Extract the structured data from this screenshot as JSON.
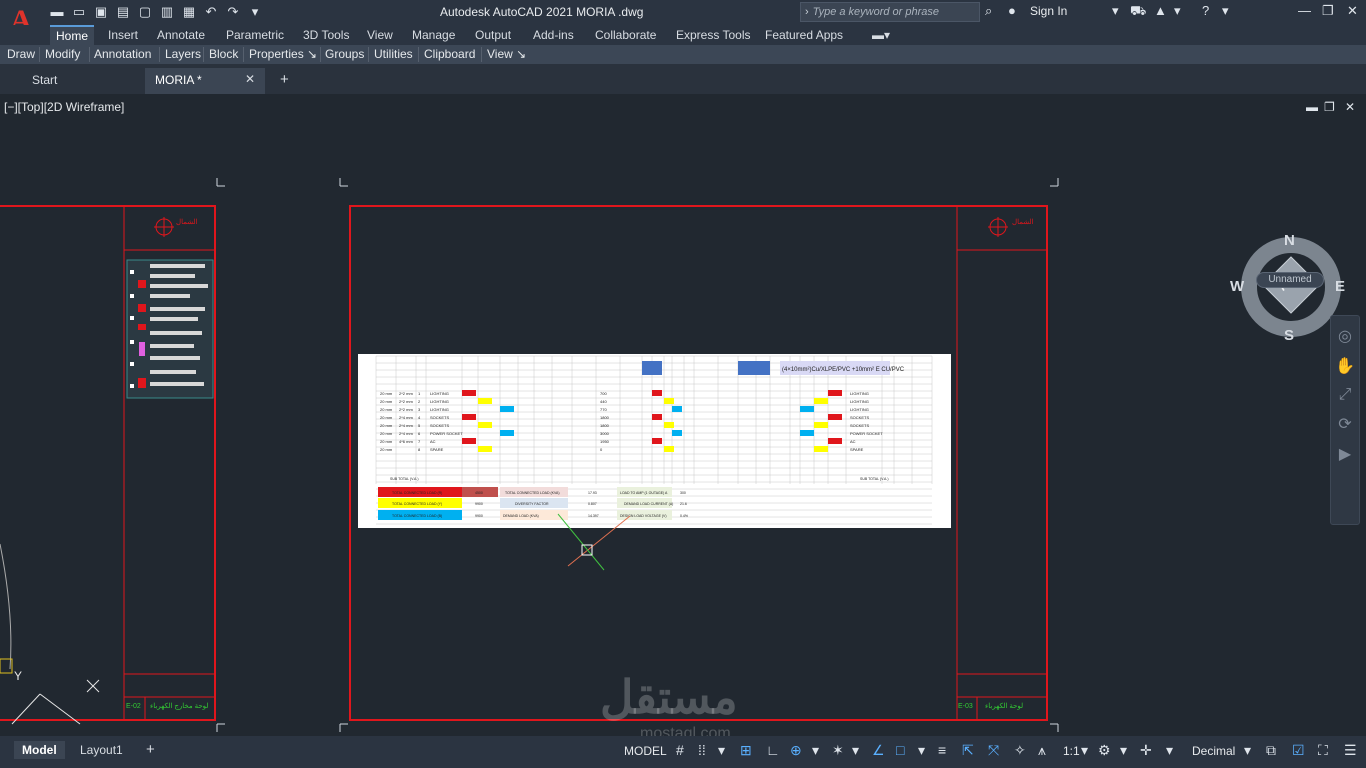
{
  "app": {
    "title": "Autodesk AutoCAD 2021   MORIA .dwg",
    "logo_letter": "A",
    "search_placeholder": "Type a keyword or phrase",
    "sign_in": "Sign In"
  },
  "ribbon": {
    "tabs": [
      "Home",
      "Insert",
      "Annotate",
      "Parametric",
      "3D Tools",
      "View",
      "Manage",
      "Output",
      "Add-ins",
      "Collaborate",
      "Express Tools",
      "Featured Apps"
    ],
    "active_tab": "Home",
    "panels": [
      "Draw",
      "Modify",
      "Annotation",
      "Layers",
      "Block",
      "Properties ↘",
      "Groups",
      "Utilities",
      "Clipboard",
      "View ↘"
    ]
  },
  "doc_tabs": {
    "start": "Start",
    "active": "MORIA *",
    "close": "✕",
    "add": "+"
  },
  "viewport": {
    "label": "[−][Top][2D Wireframe]",
    "nav_top": "TOP",
    "compass": {
      "n": "N",
      "s": "S",
      "e": "E",
      "w": "W"
    },
    "ucs_name": "Unnamed"
  },
  "sheets": {
    "left_sheet_code": "E-02",
    "right_sheet_code": "E-03",
    "left_footer_title": "لوحة مخارج الكهرباء",
    "right_footer_title": "لوحة الكهرباء",
    "logo_text": "الشمال"
  },
  "schedule": {
    "banner": "(4×10mm²)Cu/XLPE/PVC +10mm² E CU/PVC",
    "totals": {
      "sub_total_left": "SUB TOTAL (V.A.)",
      "sub_total_right": "SUB TOTAL (V.A.)",
      "row1": [
        "TOTAL CONNECTED LOAD (R)",
        "TOTAL CONNECTED LOAD (KVA)",
        "LOAD TO AMP (1 OUTAGE) A"
      ],
      "row2": [
        "TOTAL CONNECTED LOAD (Y)",
        "DIVERSITY FACTOR",
        "DEMAND LOAD CURRENT (A)"
      ],
      "row3": [
        "TOTAL CONNECTED LOAD (B)",
        "DEMAND LOAD (KVA)",
        "DESIGN LOAD VOLTAGE (V)"
      ],
      "values": [
        "4500",
        "9900",
        "9900",
        "17.93",
        "0.807",
        "14.397",
        "300",
        "21.6",
        "0.4%"
      ]
    },
    "rows": [
      {
        "desc": "LIGHTING",
        "size": "20 mm",
        "wire": "2*2 mm",
        "no": "1",
        "va": "700"
      },
      {
        "desc": "LIGHTING",
        "size": "20 mm",
        "wire": "2*2 mm",
        "no": "2",
        "va": "440"
      },
      {
        "desc": "LIGHTING",
        "size": "20 mm",
        "wire": "2*2 mm",
        "no": "3",
        "va": "770"
      },
      {
        "desc": "SOCKETS",
        "size": "20 mm",
        "wire": "2*4 mm",
        "no": "4",
        "va": "1800"
      },
      {
        "desc": "SOCKETS",
        "size": "20 mm",
        "wire": "2*4 mm",
        "no": "5",
        "va": "1800"
      },
      {
        "desc": "POWER SOCKET",
        "size": "20 mm",
        "wire": "2*4 mm",
        "no": "6",
        "va": "3000"
      },
      {
        "desc": "AC",
        "size": "20 mm",
        "wire": "4*6 mm",
        "no": "7",
        "va": "1950"
      },
      {
        "desc": "SPARE",
        "size": "20 mm",
        "wire": "",
        "no": "8",
        "va": "0"
      }
    ]
  },
  "status": {
    "tabs": [
      "Model",
      "Layout1"
    ],
    "active_tab": "Model",
    "add": "+",
    "model_label": "MODEL",
    "scale": "1:1",
    "units": "Decimal"
  },
  "watermark": {
    "main": "مستقل",
    "sub": "mostaql.com"
  }
}
